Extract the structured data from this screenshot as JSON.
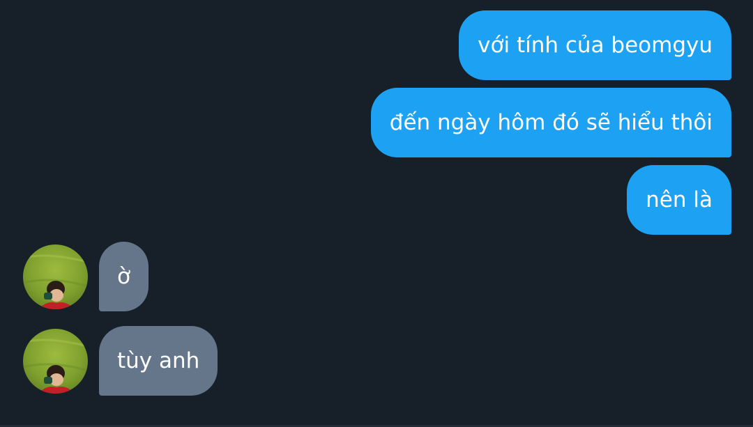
{
  "colors": {
    "background": "#171f29",
    "outgoing_bubble": "#1da1f2",
    "incoming_bubble": "#66768a",
    "text": "#ffffff"
  },
  "messages": [
    {
      "direction": "outgoing",
      "text": "với tính của beomgyu"
    },
    {
      "direction": "outgoing",
      "text": "đến ngày hôm đó sẽ hiểu thôi"
    },
    {
      "direction": "outgoing",
      "text": "nên là"
    },
    {
      "direction": "incoming",
      "text": "ờ",
      "avatar": "contact-avatar"
    },
    {
      "direction": "incoming",
      "text": "tùy anh",
      "avatar": "contact-avatar"
    }
  ]
}
